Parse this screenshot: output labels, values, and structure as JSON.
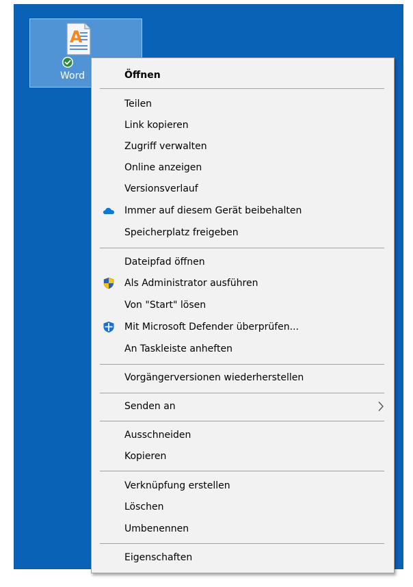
{
  "desktop": {
    "icon_label": "Word"
  },
  "menu": {
    "items": [
      {
        "label": "Öffnen"
      },
      {
        "label": "Teilen"
      },
      {
        "label": "Link kopieren"
      },
      {
        "label": "Zugriff verwalten"
      },
      {
        "label": "Online anzeigen"
      },
      {
        "label": "Versionsverlauf"
      },
      {
        "label": "Immer auf diesem Gerät beibehalten",
        "icon": "onedrive-cloud-icon"
      },
      {
        "label": "Speicherplatz freigeben"
      },
      {
        "label": "Dateipfad öffnen"
      },
      {
        "label": "Als Administrator ausführen",
        "icon": "uac-shield-icon"
      },
      {
        "label": "Von \"Start\" lösen"
      },
      {
        "label": "Mit Microsoft Defender überprüfen...",
        "icon": "defender-icon"
      },
      {
        "label": "An Taskleiste anheften"
      },
      {
        "label": "Vorgängerversionen wiederherstellen"
      },
      {
        "label": "Senden an",
        "icon": "chevron-right-icon"
      },
      {
        "label": "Ausschneiden"
      },
      {
        "label": "Kopieren"
      },
      {
        "label": "Verknüpfung erstellen"
      },
      {
        "label": "Löschen"
      },
      {
        "label": "Umbenennen"
      },
      {
        "label": "Eigenschaften"
      }
    ]
  },
  "colors": {
    "desktop_background": "#0a62b7",
    "menu_background": "#f2f2f2",
    "separator": "#a0a0a0",
    "onedrive_blue": "#0f78d4",
    "sync_check_green": "#2e8b3d"
  }
}
